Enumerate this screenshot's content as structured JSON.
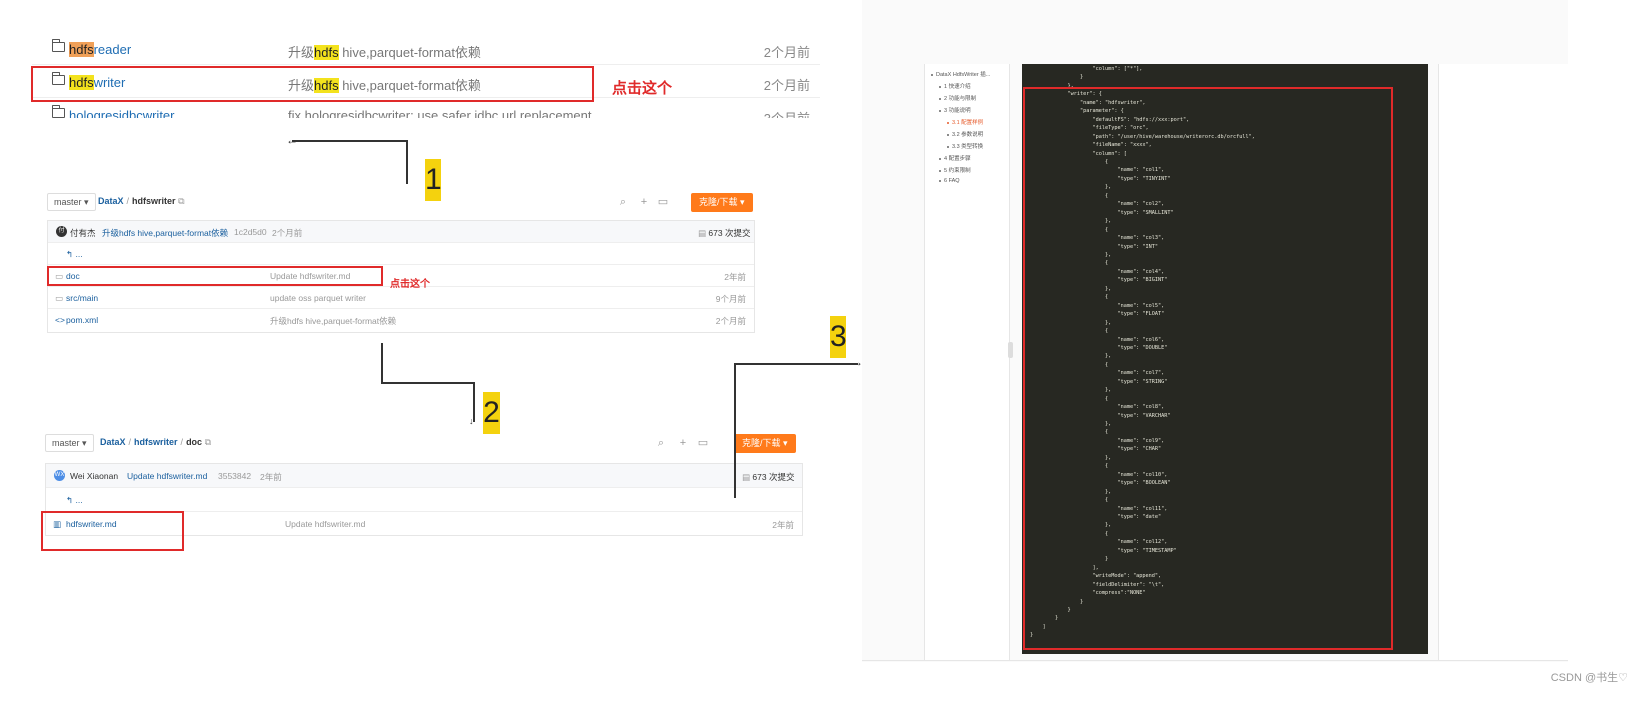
{
  "search_results": {
    "rows": [
      {
        "name_hl": "hdfs",
        "name_rest": "reader",
        "msg_pre": "升级",
        "msg_hl": "hdfs",
        "msg_post": " hive,parquet-format依赖",
        "time": "2个月前"
      },
      {
        "name_hl": "hdfs",
        "name_rest": "writer",
        "msg_pre": "升级",
        "msg_hl": "hdfs",
        "msg_post": " hive,parquet-format依赖",
        "time": "2个月前"
      },
      {
        "name_hl": "",
        "name_rest": "hologresjdbcwriter",
        "msg_pre": "fix hologresjdbcwriter: use safer jdbc url replacement",
        "msg_hl": "",
        "msg_post": "",
        "time": "3个月前"
      }
    ],
    "click_note": "点击这个"
  },
  "steps": {
    "one": "1",
    "two": "2",
    "three": "3"
  },
  "repo1": {
    "branch": "master ▾",
    "crumb_root": "DataX",
    "crumb_sep": "/",
    "crumb_current": "hdfswriter",
    "clone_label": "克隆/下载 ▾",
    "commit": {
      "avatar": "付",
      "author": "付有杰",
      "message": "升级hdfs hive,parquet-format依赖",
      "sha": "1c2d5d0",
      "time": "2个月前",
      "count": "673 次提交"
    },
    "up": "↰ ...",
    "files": [
      {
        "name": "doc",
        "message": "Update hdfswriter.md",
        "time": "2年前"
      },
      {
        "name": "src/main",
        "message": "update oss parquet writer",
        "time": "9个月前"
      },
      {
        "name": "pom.xml",
        "message": "升级hdfs hive,parquet-format依赖",
        "time": "2个月前"
      }
    ],
    "click_note": "点击这个"
  },
  "repo2": {
    "branch": "master ▾",
    "crumb_root": "DataX",
    "crumb_mid": "hdfswriter",
    "crumb_current": "doc",
    "crumb_sep": "/",
    "clone_label": "克隆/下载 ▾",
    "commit": {
      "avatar": "WX",
      "author": "Wei Xiaonan",
      "message": "Update hdfswriter.md",
      "sha": "3553842",
      "time": "2年前",
      "count": "673 次提交"
    },
    "up": "↰ ...",
    "files": [
      {
        "name": "hdfswriter.md",
        "message": "Update hdfswriter.md",
        "time": "2年前"
      }
    ]
  },
  "doc": {
    "toc": [
      {
        "label": "DataX HdfsWriter 插...",
        "active": false
      },
      {
        "label": "1 快速介绍",
        "active": false
      },
      {
        "label": "2 功能与限制",
        "active": false
      },
      {
        "label": "3 功能说明",
        "active": false
      },
      {
        "label": "3.1 配置样例",
        "active": true
      },
      {
        "label": "3.2 参数说明",
        "active": false
      },
      {
        "label": "3.3 类型转换",
        "active": false
      },
      {
        "label": "4 配置步骤",
        "active": false
      },
      {
        "label": "5 约束限制",
        "active": false
      },
      {
        "label": "6 FAQ",
        "active": false
      }
    ],
    "code": "                    \"column\": [\"*\"],\n                }\n            },\n            \"writer\": {\n                \"name\": \"hdfswriter\",\n                \"parameter\": {\n                    \"defaultFS\": \"hdfs://xxx:port\",\n                    \"fileType\": \"orc\",\n                    \"path\": \"/user/hive/warehouse/writerorc.db/orcfull\",\n                    \"fileName\": \"xxxx\",\n                    \"column\": [\n                        {\n                            \"name\": \"col1\",\n                            \"type\": \"TINYINT\"\n                        },\n                        {\n                            \"name\": \"col2\",\n                            \"type\": \"SMALLINT\"\n                        },\n                        {\n                            \"name\": \"col3\",\n                            \"type\": \"INT\"\n                        },\n                        {\n                            \"name\": \"col4\",\n                            \"type\": \"BIGINT\"\n                        },\n                        {\n                            \"name\": \"col5\",\n                            \"type\": \"FLOAT\"\n                        },\n                        {\n                            \"name\": \"col6\",\n                            \"type\": \"DOUBLE\"\n                        },\n                        {\n                            \"name\": \"col7\",\n                            \"type\": \"STRING\"\n                        },\n                        {\n                            \"name\": \"col8\",\n                            \"type\": \"VARCHAR\"\n                        },\n                        {\n                            \"name\": \"col9\",\n                            \"type\": \"CHAR\"\n                        },\n                        {\n                            \"name\": \"col10\",\n                            \"type\": \"BOOLEAN\"\n                        },\n                        {\n                            \"name\": \"col11\",\n                            \"type\": \"date\"\n                        },\n                        {\n                            \"name\": \"col12\",\n                            \"type\": \"TIMESTAMP\"\n                        }\n                    ],\n                    \"writeMode\": \"append\",\n                    \"fieldDelimiter\": \"\\t\",\n                    \"compress\":\"NONE\"\n                }\n            }\n        }\n    ]\n}"
  },
  "watermark": "CSDN @书生♡",
  "colors": {
    "highlight": "#f3e21d",
    "annotation_red": "#e02a2a",
    "clone_orange": "#ff7a1a",
    "code_bg": "#272822"
  }
}
